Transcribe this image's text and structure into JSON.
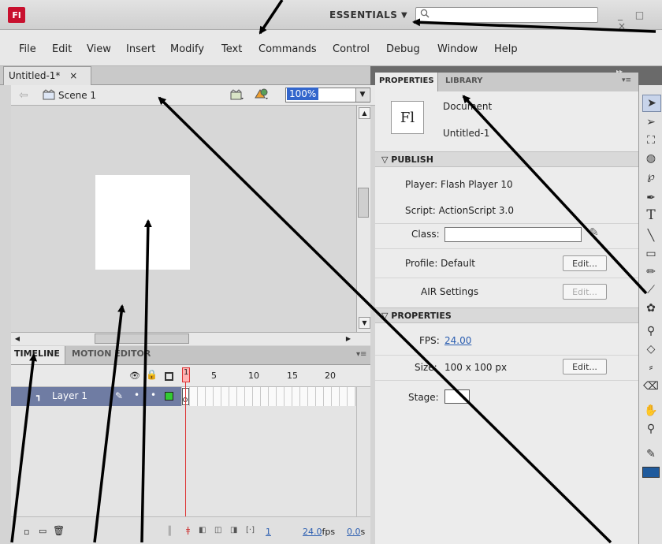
{
  "window": {
    "logo": "Fl",
    "workspace": "ESSENTIALS",
    "controls": "_ □ ×"
  },
  "menu": [
    "File",
    "Edit",
    "View",
    "Insert",
    "Modify",
    "Text",
    "Commands",
    "Control",
    "Debug",
    "Window",
    "Help"
  ],
  "document_tab": {
    "label": "Untitled-1*",
    "close": "×"
  },
  "scene": {
    "label": "Scene 1",
    "zoom": "100%"
  },
  "timeline": {
    "tabs": [
      "TIMELINE",
      "MOTION EDITOR"
    ],
    "frame_numbers": [
      "1",
      "5",
      "10",
      "15",
      "20"
    ],
    "layer": "Layer 1",
    "playhead_frame": "1",
    "current_frame": "1",
    "fps": "24.0",
    "fps_unit": "fps",
    "elapsed": "0.0",
    "elapsed_unit": "s"
  },
  "properties": {
    "tabs": [
      "PROPERTIES",
      "LIBRARY"
    ],
    "doc_icon": "Fl",
    "doc_type": "Document",
    "doc_name": "Untitled-1",
    "publish_header": "PUBLISH",
    "player": "Player: Flash Player 10",
    "script": "Script: ActionScript 3.0",
    "class_label": "Class:",
    "profile": "Profile: Default",
    "edit": "Edit...",
    "air": "AIR Settings",
    "properties_header": "PROPERTIES",
    "fps_label": "FPS:",
    "fps_value": "24.00",
    "size_label": "Size:",
    "size_value": "100 x 100 px",
    "stage_label": "Stage:"
  },
  "tools": [
    "selection-icon",
    "subselection-icon",
    "free-transform-icon",
    "3d-rotation-icon",
    "lasso-icon",
    "pen-icon",
    "text-icon",
    "line-icon",
    "rectangle-icon",
    "pencil-icon",
    "brush-icon",
    "deco-icon",
    "bone-icon",
    "paint-bucket-icon",
    "eyedropper-icon",
    "eraser-icon",
    "hand-icon",
    "zoom-icon",
    "stroke-color-icon"
  ],
  "colors": {
    "accent": "#c8102e",
    "layer_selected": "#6f7ca3",
    "link": "#2a5db0"
  }
}
